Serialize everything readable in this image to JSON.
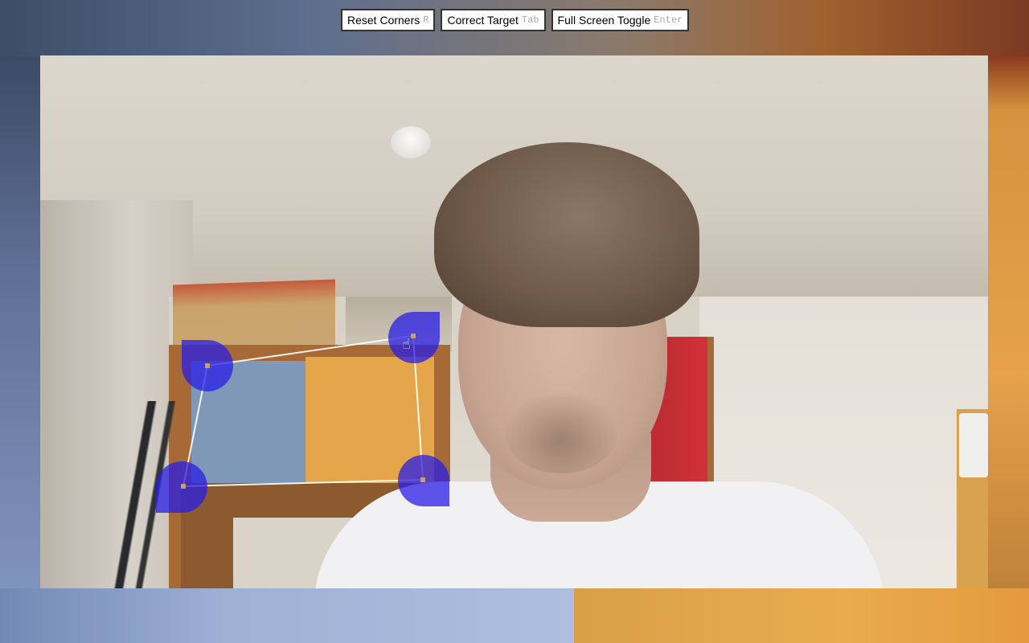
{
  "toolbar": {
    "buttons": [
      {
        "label": "Reset Corners",
        "key": "R"
      },
      {
        "label": "Correct Target",
        "key": "Tab"
      },
      {
        "label": "Full Screen Toggle",
        "key": "Enter"
      }
    ]
  },
  "overlay": {
    "corners": [
      "top-left",
      "top-right",
      "bottom-left",
      "bottom-right"
    ],
    "handle_color": "#281ee6",
    "line_color": "#ffffff"
  },
  "cursor": {
    "icon": "hand-grab-icon",
    "glyph": "☝"
  }
}
